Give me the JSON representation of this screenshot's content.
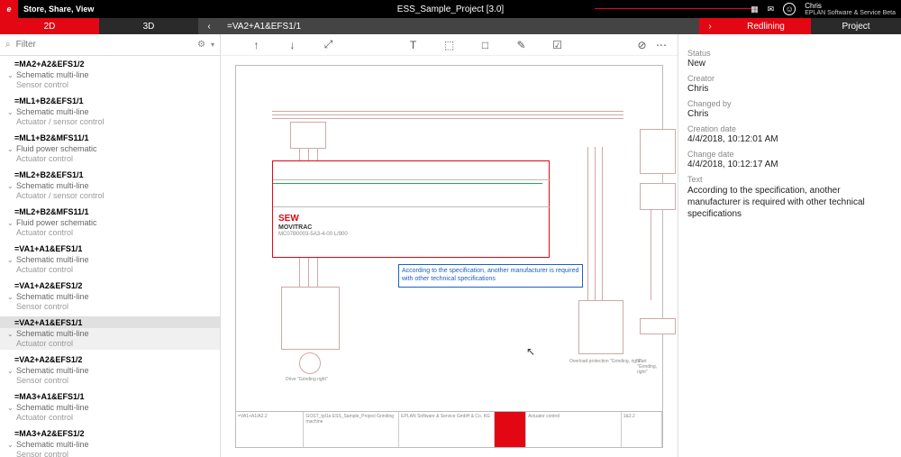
{
  "top": {
    "slogan": "Store, Share, View",
    "project": "ESS_Sample_Project [3.0]",
    "user": "Chris",
    "brand": "EPLAN Software & Service Beta"
  },
  "tabs": {
    "t2d": "2D",
    "t3d": "3D",
    "path": "=VA2+A1&EFS1/1",
    "redlining": "Redlining",
    "project": "Project"
  },
  "filter": {
    "placeholder": "Filter"
  },
  "tree": [
    {
      "id": "=MA2+A2&EFS1/2",
      "type": "Schematic multi-line",
      "detail": "Sensor control"
    },
    {
      "id": "=ML1+B2&EFS1/1",
      "type": "Schematic multi-line",
      "detail": "Actuator / sensor control"
    },
    {
      "id": "=ML1+B2&MFS11/1",
      "type": "Fluid power schematic",
      "detail": "Actuator control"
    },
    {
      "id": "=ML2+B2&EFS1/1",
      "type": "Schematic multi-line",
      "detail": "Actuator / sensor control"
    },
    {
      "id": "=ML2+B2&MFS11/1",
      "type": "Fluid power schematic",
      "detail": "Actuator control"
    },
    {
      "id": "=VA1+A1&EFS1/1",
      "type": "Schematic multi-line",
      "detail": "Actuator control"
    },
    {
      "id": "=VA1+A2&EFS1/2",
      "type": "Schematic multi-line",
      "detail": "Sensor control"
    },
    {
      "id": "=VA2+A1&EFS1/1",
      "type": "Schematic multi-line",
      "detail": "Actuator control",
      "sel": true
    },
    {
      "id": "=VA2+A2&EFS1/2",
      "type": "Schematic multi-line",
      "detail": "Sensor control"
    },
    {
      "id": "=MA3+A1&EFS1/1",
      "type": "Schematic multi-line",
      "detail": "Actuator control"
    },
    {
      "id": "=MA3+A2&EFS1/2",
      "type": "Schematic multi-line",
      "detail": "Sensor control"
    }
  ],
  "schematic": {
    "brand": "SEW",
    "brand2": "MOVITRAC",
    "brand3": "MC07B0003-5A3-4-00       L/900",
    "comment": "According to the specification, another manufacturer is required with other technical specifications",
    "blk_label1": "Drive \"Grinding right\"",
    "blk_label2": "Overload protection \"Grinding, right\"",
    "blk_label3": "Start \"Grinding, right\"",
    "tb1": "=VA1+A1/A2.2",
    "tb2": "GOST_tpl1a    ESS_Sample_Project\nGrinding machine",
    "tb3": "EPLAN Software & Service\nGmbH & Co. KG",
    "tb4": "Actuator control",
    "tb5": "1&2.2"
  },
  "detail": {
    "status_l": "Status",
    "status": "New",
    "creator_l": "Creator",
    "creator": "Chris",
    "changed_l": "Changed by",
    "changed": "Chris",
    "cdate_l": "Creation date",
    "cdate": "4/4/2018, 10:12:01 AM",
    "mdate_l": "Change date",
    "mdate": "4/4/2018, 10:12:17 AM",
    "text_l": "Text",
    "text": "According to the specification, another manufacturer is required with other technical specifications"
  }
}
